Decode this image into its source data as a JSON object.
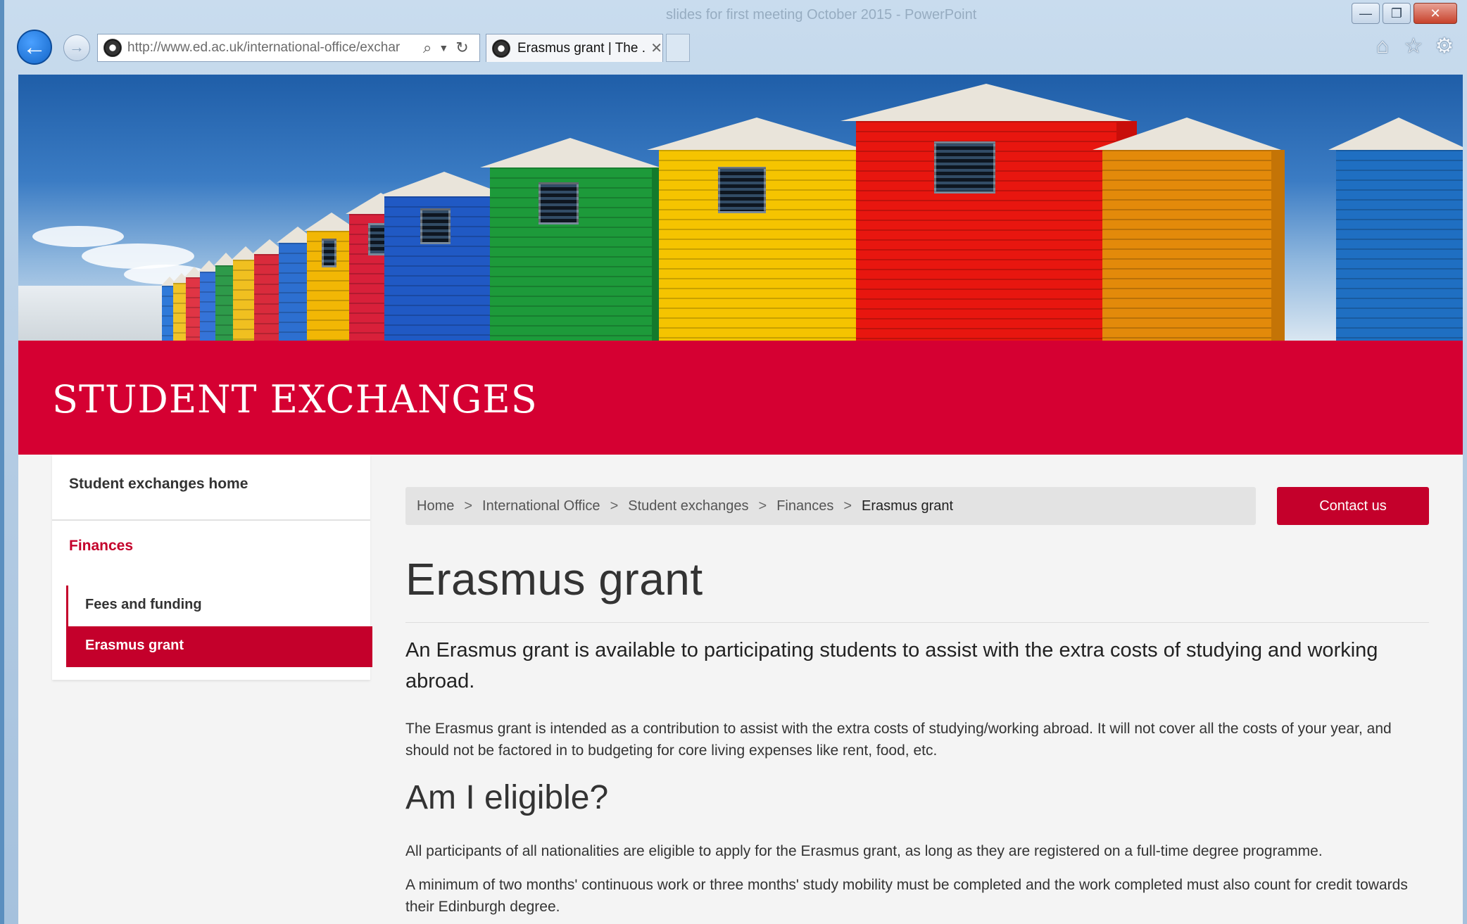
{
  "browser": {
    "window_title": "slides for first meeting October 2015 - PowerPoint",
    "url": "http://www.ed.ac.uk/international-office/exchar",
    "tab_title": "Erasmus grant | The ...",
    "window_buttons": {
      "minimize": "—",
      "restore": "❐",
      "close": "✕"
    },
    "toolbar_icons": [
      "home-icon",
      "star-icon",
      "gear-icon"
    ]
  },
  "site": {
    "banner_title": "STUDENT EXCHANGES"
  },
  "sidebar": {
    "home": "Student exchanges home",
    "section": "Finances",
    "items": [
      {
        "label": "Fees and funding",
        "active": false
      },
      {
        "label": "Erasmus grant",
        "active": true
      }
    ]
  },
  "breadcrumb": {
    "items": [
      "Home",
      "International Office",
      "Student exchanges",
      "Finances"
    ],
    "current": "Erasmus grant",
    "separator": ">"
  },
  "contact_button": "Contact us",
  "content": {
    "title": "Erasmus grant",
    "lead": "An Erasmus grant is available to participating students to assist with the extra costs of studying and working abroad.",
    "paragraph1": "The Erasmus grant is intended as a contribution to assist with the extra costs of studying/working abroad. It will not cover all the costs of your year, and should not be factored in to budgeting for core living expenses like rent, food, etc.",
    "heading2": "Am I eligible?",
    "paragraph2": "All participants of all nationalities are eligible to apply for the Erasmus grant, as long as they are registered on a full-time degree programme.",
    "paragraph3": "A minimum of two months' continuous work or three months' study mobility must be completed and the work completed must also count for credit towards their Edinburgh degree."
  },
  "colors": {
    "brand_red": "#d50032",
    "accent_red": "#c4002b"
  }
}
